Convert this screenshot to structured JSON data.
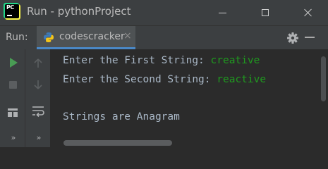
{
  "window": {
    "title": "Run - pythonProject"
  },
  "run_panel": {
    "label": "Run:",
    "tab_label": "codescracker",
    "tab_close": "×"
  },
  "console": {
    "lines": [
      {
        "prompt": "Enter the First String: ",
        "input": "creative"
      },
      {
        "prompt": "Enter the Second String: ",
        "input": "reactive"
      },
      {
        "prompt": "",
        "input": ""
      },
      {
        "prompt": "Strings are Anagram",
        "input": ""
      }
    ]
  },
  "icons": {
    "app": "pycharm-icon",
    "python": "python-file-icon",
    "settings": "gear-icon",
    "hide": "minimize-panel-icon",
    "rerun": "play-icon",
    "stop": "stop-icon",
    "layout": "layout-icon",
    "up": "arrow-up-icon",
    "down": "arrow-down-icon",
    "wrap": "soft-wrap-icon",
    "more": "chevron-double-right-icon"
  },
  "colors": {
    "background": "#2b2b2b",
    "toolbar": "#3c3f41",
    "text": "#a9b7c6",
    "user_input": "#1f9a1f",
    "run_green": "#499c54",
    "tab_underline": "#4a88c7"
  },
  "toolbar_glyphs": {
    "more": "»"
  }
}
